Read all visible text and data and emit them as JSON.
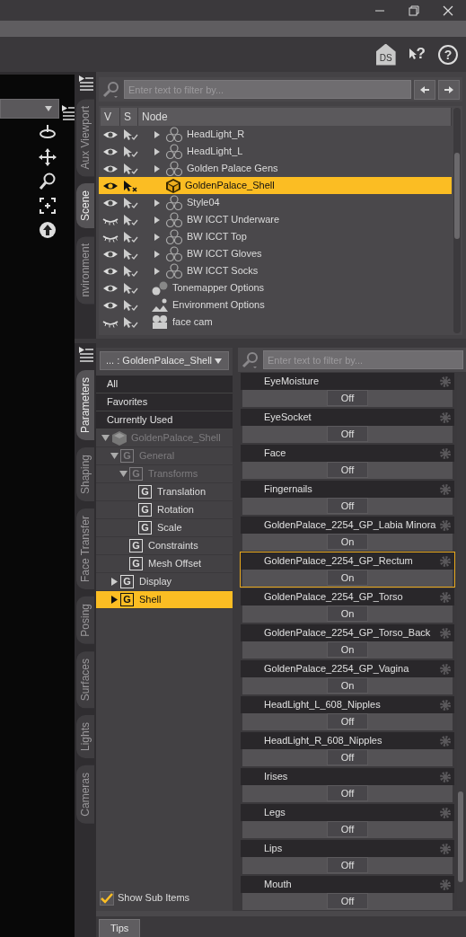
{
  "toolbar": {
    "home_label": "DS",
    "whats_this_glyph": "?",
    "help_glyph": "?"
  },
  "scene": {
    "tabs": [
      {
        "label": "Aux Viewport",
        "selected": false
      },
      {
        "label": "Scene",
        "selected": true
      },
      {
        "label": "nvironment",
        "selected": false
      }
    ],
    "filter": {
      "placeholder": "Enter text to filter by..."
    },
    "columns": [
      "V",
      "S",
      "Node"
    ],
    "rows": [
      {
        "name": "HeadLight_R",
        "visible": true,
        "kind": "group",
        "expanded": false,
        "selected": false
      },
      {
        "name": "HeadLight_L",
        "visible": true,
        "kind": "group",
        "expanded": false,
        "selected": false
      },
      {
        "name": "Golden Palace Gens",
        "visible": true,
        "kind": "group",
        "expanded": false,
        "selected": false
      },
      {
        "name": "GoldenPalace_Shell",
        "visible": true,
        "kind": "prop",
        "selected": true
      },
      {
        "name": "Style04",
        "visible": true,
        "kind": "group",
        "expanded": false,
        "selected": false
      },
      {
        "name": "BW ICCT Underware",
        "visible": false,
        "kind": "group",
        "expanded": false,
        "selected": false
      },
      {
        "name": "BW ICCT Top",
        "visible": false,
        "kind": "group",
        "expanded": false,
        "selected": false
      },
      {
        "name": "BW ICCT Gloves",
        "visible": true,
        "kind": "group",
        "expanded": false,
        "selected": false
      },
      {
        "name": "BW ICCT Socks",
        "visible": true,
        "kind": "group",
        "expanded": false,
        "selected": false
      },
      {
        "name": "Tonemapper Options",
        "visible": true,
        "kind": "tonemapper",
        "selected": false
      },
      {
        "name": "Environment Options",
        "visible": true,
        "kind": "environment",
        "selected": false
      },
      {
        "name": "face cam",
        "visible": false,
        "kind": "camera",
        "selected": false
      }
    ]
  },
  "parameters": {
    "tabs": [
      {
        "label": "Parameters",
        "selected": true
      },
      {
        "label": "Shaping",
        "selected": false
      },
      {
        "label": "Face Transfer",
        "selected": false
      },
      {
        "label": "Posing",
        "selected": false
      },
      {
        "label": "Surfaces",
        "selected": false
      },
      {
        "label": "Lights",
        "selected": false
      },
      {
        "label": "Cameras",
        "selected": false
      }
    ],
    "node_menu": "... : GoldenPalace_Shell",
    "filters": [
      {
        "label": "All",
        "selected": false
      },
      {
        "label": "Favorites",
        "selected": false
      },
      {
        "label": "Currently Used",
        "selected": false
      }
    ],
    "tree": [
      {
        "label": "GoldenPalace_Shell",
        "kind": "node",
        "dimmed": true,
        "expanded": true,
        "selected": false,
        "children": [
          {
            "label": "General",
            "kind": "group",
            "icon_letter": "G",
            "dimmed": true,
            "expanded": true,
            "selected": false,
            "children": [
              {
                "label": "Transforms",
                "kind": "group",
                "icon_letter": "G",
                "dimmed": true,
                "expanded": true,
                "selected": false,
                "children": [
                  {
                    "label": "Translation",
                    "kind": "group",
                    "icon_letter": "G",
                    "dimmed": false,
                    "selected": false
                  },
                  {
                    "label": "Rotation",
                    "kind": "group",
                    "icon_letter": "G",
                    "dimmed": false,
                    "selected": false
                  },
                  {
                    "label": "Scale",
                    "kind": "group",
                    "icon_letter": "G",
                    "dimmed": false,
                    "selected": false
                  }
                ]
              },
              {
                "label": "Constraints",
                "kind": "group",
                "icon_letter": "G",
                "dimmed": false,
                "selected": false
              },
              {
                "label": "Mesh Offset",
                "kind": "group",
                "icon_letter": "G",
                "dimmed": false,
                "selected": false
              }
            ]
          },
          {
            "label": "Display",
            "kind": "group",
            "icon_letter": "G",
            "dimmed": false,
            "expanded": false,
            "selected": false
          },
          {
            "label": "Shell",
            "kind": "group",
            "icon_letter": "G",
            "dimmed": false,
            "expanded": false,
            "selected": true
          }
        ]
      }
    ],
    "show_sub_items": {
      "label": "Show Sub Items",
      "checked": true
    },
    "filter": {
      "placeholder": "Enter text to filter by..."
    },
    "properties": [
      {
        "name": "EyeMoisture",
        "value": "Off",
        "highlighted": false
      },
      {
        "name": "EyeSocket",
        "value": "Off",
        "highlighted": false
      },
      {
        "name": "Face",
        "value": "Off",
        "highlighted": false
      },
      {
        "name": "Fingernails",
        "value": "Off",
        "highlighted": false
      },
      {
        "name": "GoldenPalace_2254_GP_Labia Minora",
        "value": "On",
        "highlighted": false
      },
      {
        "name": "GoldenPalace_2254_GP_Rectum",
        "value": "On",
        "highlighted": true
      },
      {
        "name": "GoldenPalace_2254_GP_Torso",
        "value": "On",
        "highlighted": false
      },
      {
        "name": "GoldenPalace_2254_GP_Torso_Back",
        "value": "On",
        "highlighted": false
      },
      {
        "name": "GoldenPalace_2254_GP_Vagina",
        "value": "On",
        "highlighted": false
      },
      {
        "name": "HeadLight_L_608_Nipples",
        "value": "Off",
        "highlighted": false
      },
      {
        "name": "HeadLight_R_608_Nipples",
        "value": "Off",
        "highlighted": false
      },
      {
        "name": "Irises",
        "value": "Off",
        "highlighted": false
      },
      {
        "name": "Legs",
        "value": "Off",
        "highlighted": false
      },
      {
        "name": "Lips",
        "value": "Off",
        "highlighted": false
      },
      {
        "name": "Mouth",
        "value": "Off",
        "highlighted": false
      }
    ]
  },
  "bottom_tabs": [
    {
      "label": "Tips",
      "selected": true
    }
  ]
}
